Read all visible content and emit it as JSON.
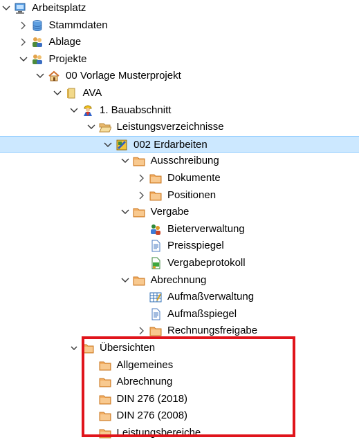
{
  "tree": {
    "items": [
      {
        "label": "Arbeitsplatz",
        "level": 0,
        "chevron": "down",
        "icon": "computer-icon"
      },
      {
        "label": "Stammdaten",
        "level": 1,
        "chevron": "right",
        "icon": "database-icon"
      },
      {
        "label": "Ablage",
        "level": 1,
        "chevron": "right",
        "icon": "users-icon"
      },
      {
        "label": "Projekte",
        "level": 1,
        "chevron": "down",
        "icon": "users-icon"
      },
      {
        "label": "00 Vorlage Musterprojekt",
        "level": 2,
        "chevron": "down",
        "icon": "house-icon"
      },
      {
        "label": "AVA",
        "level": 3,
        "chevron": "down",
        "icon": "book-icon"
      },
      {
        "label": "1. Bauabschnitt",
        "level": 4,
        "chevron": "down",
        "icon": "worker-icon"
      },
      {
        "label": "Leistungsverzeichnisse",
        "level": 5,
        "chevron": "down",
        "icon": "folder-open-icon"
      },
      {
        "label": "002 Erdarbeiten",
        "level": 6,
        "chevron": "down",
        "icon": "lv-icon",
        "selected": true
      },
      {
        "label": "Ausschreibung",
        "level": 7,
        "chevron": "down",
        "icon": "folder-icon"
      },
      {
        "label": "Dokumente",
        "level": 8,
        "chevron": "right",
        "icon": "folder-icon"
      },
      {
        "label": "Positionen",
        "level": 8,
        "chevron": "right",
        "icon": "folder-icon"
      },
      {
        "label": "Vergabe",
        "level": 7,
        "chevron": "down",
        "icon": "folder-icon"
      },
      {
        "label": "Bieterverwaltung",
        "level": 8,
        "chevron": "none",
        "icon": "bidders-icon"
      },
      {
        "label": "Preisspiegel",
        "level": 8,
        "chevron": "none",
        "icon": "document-icon"
      },
      {
        "label": "Vergabeprotokoll",
        "level": 8,
        "chevron": "none",
        "icon": "protocol-icon"
      },
      {
        "label": "Abrechnung",
        "level": 7,
        "chevron": "down",
        "icon": "folder-icon"
      },
      {
        "label": "Aufmaßverwaltung",
        "level": 8,
        "chevron": "none",
        "icon": "spreadsheet-icon"
      },
      {
        "label": "Aufmaßspiegel",
        "level": 8,
        "chevron": "none",
        "icon": "document-icon"
      },
      {
        "label": "Rechnungsfreigabe",
        "level": 8,
        "chevron": "right",
        "icon": "folder-icon"
      },
      {
        "label": "Übersichten",
        "level": 4,
        "chevron": "down-small",
        "icon": "folder-icon"
      },
      {
        "label": "Allgemeines",
        "level": 5,
        "chevron": "none",
        "icon": "folder-icon"
      },
      {
        "label": "Abrechnung",
        "level": 5,
        "chevron": "none",
        "icon": "folder-icon"
      },
      {
        "label": "DIN 276 (2018)",
        "level": 5,
        "chevron": "none",
        "icon": "folder-icon"
      },
      {
        "label": "DIN 276 (2008)",
        "level": 5,
        "chevron": "none",
        "icon": "folder-icon"
      },
      {
        "label": "Leistungsbereiche",
        "level": 5,
        "chevron": "none",
        "icon": "folder-icon"
      }
    ]
  },
  "colors": {
    "selection_bg": "#cce8ff",
    "selection_border": "#99d1ff",
    "highlight_border": "#e0141b",
    "folder_fill": "#f3ae63",
    "folder_tab": "#f8c98f"
  }
}
